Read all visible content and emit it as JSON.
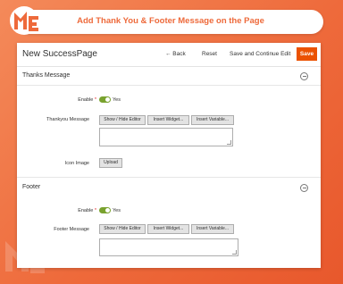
{
  "banner": {
    "title": "Add Thank You & Footer Message on the Page"
  },
  "page": {
    "title": "New SuccessPage"
  },
  "actions": {
    "back_label": "← Back",
    "reset_label": "Reset",
    "save_continue_label": "Save and Continue Edit",
    "save_label": "Save"
  },
  "thanks": {
    "section_title": "Thanks Message",
    "enable_label": "Enable",
    "required_mark": "*",
    "enable_value": "Yes",
    "message_label": "Thankyou Message",
    "editor_buttons": [
      "Show / Hide Editor",
      "Insert Widget...",
      "Insert Variable..."
    ],
    "icon_label": "Icon Image",
    "upload_label": "Upload"
  },
  "footer": {
    "section_title": "Footer",
    "enable_label": "Enable",
    "required_mark": "*",
    "enable_value": "Yes",
    "message_label": "Footer Message",
    "editor_buttons": [
      "Show / Hide Editor",
      "Insert Widget...",
      "Insert Variable..."
    ]
  },
  "colors": {
    "accent": "#eb5202",
    "brand": "#ee6a3b",
    "toggle_on": "#79a22e"
  }
}
